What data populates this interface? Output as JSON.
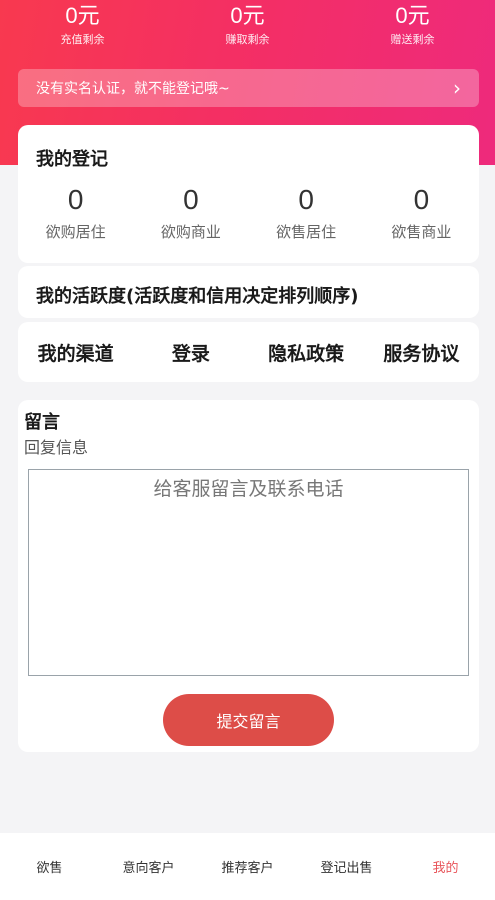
{
  "balances": [
    {
      "value": "0元",
      "label": "充值剩余"
    },
    {
      "value": "0元",
      "label": "赚取剩余"
    },
    {
      "value": "0元",
      "label": "赠送剩余"
    }
  ],
  "notice": {
    "text": "没有实名认证，就不能登记哦~",
    "arrow": "›"
  },
  "registration": {
    "title": "我的登记",
    "stats": [
      {
        "value": "0",
        "label": "欲购居住"
      },
      {
        "value": "0",
        "label": "欲购商业"
      },
      {
        "value": "0",
        "label": "欲售居住"
      },
      {
        "value": "0",
        "label": "欲售商业"
      }
    ]
  },
  "activity": {
    "title": "我的活跃度(活跃度和信用决定排列顺序)"
  },
  "links": [
    "我的渠道",
    "登录",
    "隐私政策",
    "服务协议"
  ],
  "message": {
    "title": "留言",
    "subtitle": "回复信息",
    "placeholder": "给客服留言及联系电话",
    "submit_label": "提交留言"
  },
  "tabbar": {
    "tabs": [
      "欲售",
      "意向客户",
      "推荐客户",
      "登记出售",
      "我的"
    ],
    "active_index": 4,
    "active_color": "#e8545a"
  },
  "colors": {
    "brand_gradient_start": "#f8394f",
    "brand_gradient_end": "#ee2a7c",
    "submit_button": "#dd4d48"
  }
}
